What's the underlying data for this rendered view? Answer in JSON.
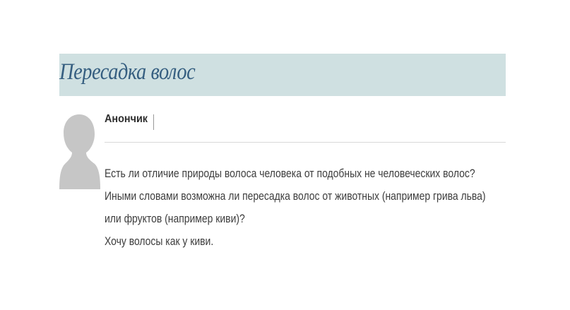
{
  "header": {
    "title": "Пересадка волос"
  },
  "post": {
    "author": "Анончик",
    "avatar_icon": "person-silhouette-icon",
    "lines": [
      "Есть ли отличие природы волоса человека от подобных не человеческих волос?",
      "Иными словами возможна ли пересадка волос от животных (например грива льва)",
      "или фруктов (например киви)?",
      "Хочу волосы как у киви."
    ]
  },
  "colors": {
    "title_bar": "#cfe0e1",
    "title_text": "#355e80",
    "avatar": "#c6c6c6",
    "body_text": "#3d3d3d"
  }
}
